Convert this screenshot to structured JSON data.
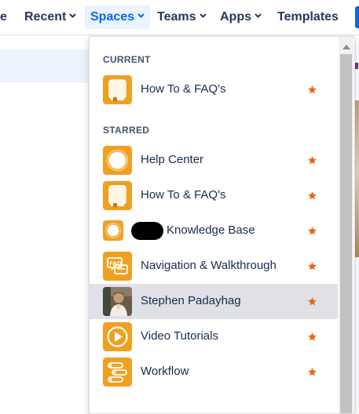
{
  "nav": {
    "items": [
      {
        "label": "e"
      },
      {
        "label": "Recent"
      },
      {
        "label": "Spaces"
      },
      {
        "label": "Teams"
      },
      {
        "label": "Apps"
      },
      {
        "label": "Templates"
      }
    ]
  },
  "dropdown": {
    "current_header": "CURRENT",
    "starred_header": "STARRED",
    "current": [
      {
        "label": "How To & FAQ's",
        "icon": "book-icon",
        "starred": true
      }
    ],
    "starred": [
      {
        "label": "Help Center",
        "icon": "help-circle-icon",
        "starred": true
      },
      {
        "label": "How To & FAQ's",
        "icon": "book-icon",
        "starred": true
      },
      {
        "label": "Knowledge Base",
        "icon": "knowledge-circle-icon",
        "starred": true
      },
      {
        "label": "Navigation & Walkthrough",
        "icon": "faq-chat-icon",
        "starred": true
      },
      {
        "label": "Stephen Padayhag",
        "icon": "user-avatar",
        "starred": true
      },
      {
        "label": "Video Tutorials",
        "icon": "play-icon",
        "starred": true
      },
      {
        "label": "Workflow",
        "icon": "workflow-icon",
        "starred": true
      }
    ]
  },
  "colors": {
    "accent": "#0c66e4",
    "icon_orange": "#f0a020",
    "star": "#e56910",
    "hover_row": "#dfe1e6"
  }
}
